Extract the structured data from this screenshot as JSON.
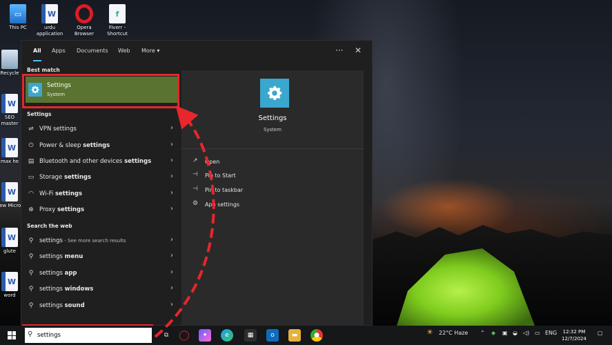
{
  "desktop": {
    "icons": [
      {
        "label": "This PC",
        "icon": "computer-icon"
      },
      {
        "label": "urdu application",
        "icon": "word-document-icon"
      },
      {
        "label": "Opera Browser",
        "icon": "opera-icon"
      },
      {
        "label": "Fiverr - Shortcut",
        "icon": "shortcut-icon"
      },
      {
        "label": "Recycle",
        "icon": "recycle-bin-icon"
      },
      {
        "label": "SEO master",
        "icon": "word-document-icon"
      },
      {
        "label": "max he",
        "icon": "word-document-icon"
      },
      {
        "label": "New Micros",
        "icon": "word-document-icon"
      },
      {
        "label": "glute",
        "icon": "word-document-icon"
      },
      {
        "label": "word",
        "icon": "word-document-icon"
      }
    ]
  },
  "nav": {
    "tabs": [
      "All",
      "Apps",
      "Documents",
      "Web",
      "More ▾"
    ],
    "active_tab": "All",
    "more_options": "···",
    "close": "✕"
  },
  "best_match": {
    "header": "Best match",
    "title": "Settings",
    "subtitle": "System"
  },
  "settings_section": {
    "header": "Settings",
    "items": [
      {
        "pre": "",
        "bold": "",
        "post": "VPN settings",
        "icon": "vpn-icon"
      },
      {
        "pre": "Power & sleep ",
        "bold": "settings",
        "post": "",
        "icon": "power-icon"
      },
      {
        "pre": "Bluetooth and other devices ",
        "bold": "settings",
        "post": "",
        "icon": "bluetooth-icon"
      },
      {
        "pre": "Storage ",
        "bold": "settings",
        "post": "",
        "icon": "storage-icon"
      },
      {
        "pre": "Wi-Fi ",
        "bold": "settings",
        "post": "",
        "icon": "wifi-icon"
      },
      {
        "pre": "Proxy ",
        "bold": "settings",
        "post": "",
        "icon": "globe-icon"
      }
    ]
  },
  "web_section": {
    "header": "Search the web",
    "items": [
      {
        "pre": "settings",
        "bold": "",
        "post": " - See more search results"
      },
      {
        "pre": "settings ",
        "bold": "menu",
        "post": ""
      },
      {
        "pre": "settings ",
        "bold": "app",
        "post": ""
      },
      {
        "pre": "settings ",
        "bold": "windows",
        "post": ""
      },
      {
        "pre": "settings ",
        "bold": "sound",
        "post": ""
      }
    ]
  },
  "preview": {
    "title": "Settings",
    "subtitle": "System",
    "actions": [
      {
        "label": "Open",
        "icon": "open-icon"
      },
      {
        "label": "Pin to Start",
        "icon": "pin-icon"
      },
      {
        "label": "Pin to taskbar",
        "icon": "pin-icon"
      },
      {
        "label": "App settings",
        "icon": "gear-icon"
      }
    ]
  },
  "taskbar": {
    "search_value": "settings",
    "weather": "22°C  Haze",
    "language": "ENG",
    "time": "12:32 PM",
    "date": "12/7/2024"
  },
  "colors": {
    "accent": "#4cc2ff",
    "best_match_bg": "#5b7330",
    "highlight_red": "#e8262c",
    "settings_blue": "#3aa7cf"
  }
}
